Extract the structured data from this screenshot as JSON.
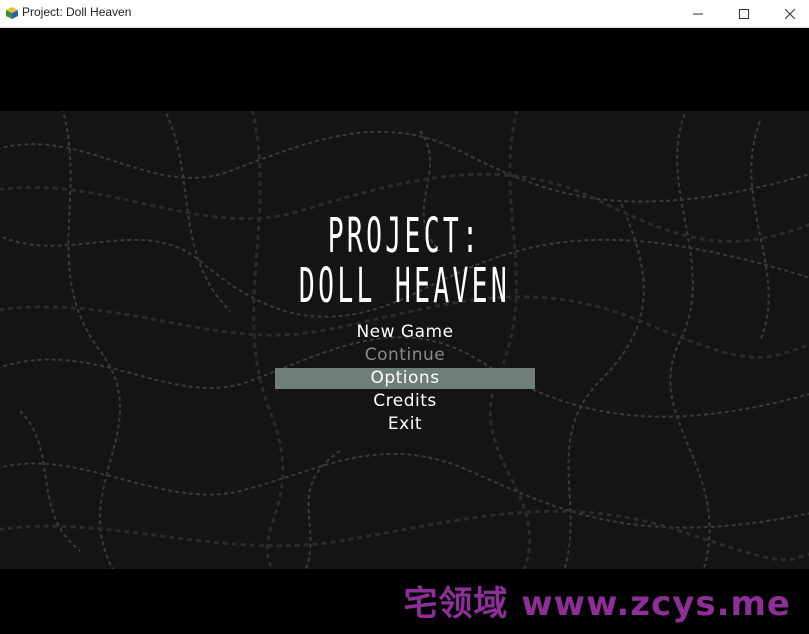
{
  "window": {
    "title": "Project: Doll Heaven",
    "minimize_icon": "minimize-icon",
    "maximize_icon": "maximize-icon",
    "close_icon": "close-icon"
  },
  "game": {
    "logo_line1": "PROJECT:",
    "logo_line2": "DOLL HEAVEN",
    "menu": [
      {
        "label": "New Game",
        "state": "normal"
      },
      {
        "label": "Continue",
        "state": "disabled"
      },
      {
        "label": "Options",
        "state": "selected"
      },
      {
        "label": "Credits",
        "state": "normal"
      },
      {
        "label": "Exit",
        "state": "normal"
      }
    ],
    "highlight_color": "#6f7f77",
    "background_color": "#141414"
  },
  "watermark": {
    "text": "宅领域 www.zcys.me",
    "color": "#8e2f98"
  }
}
